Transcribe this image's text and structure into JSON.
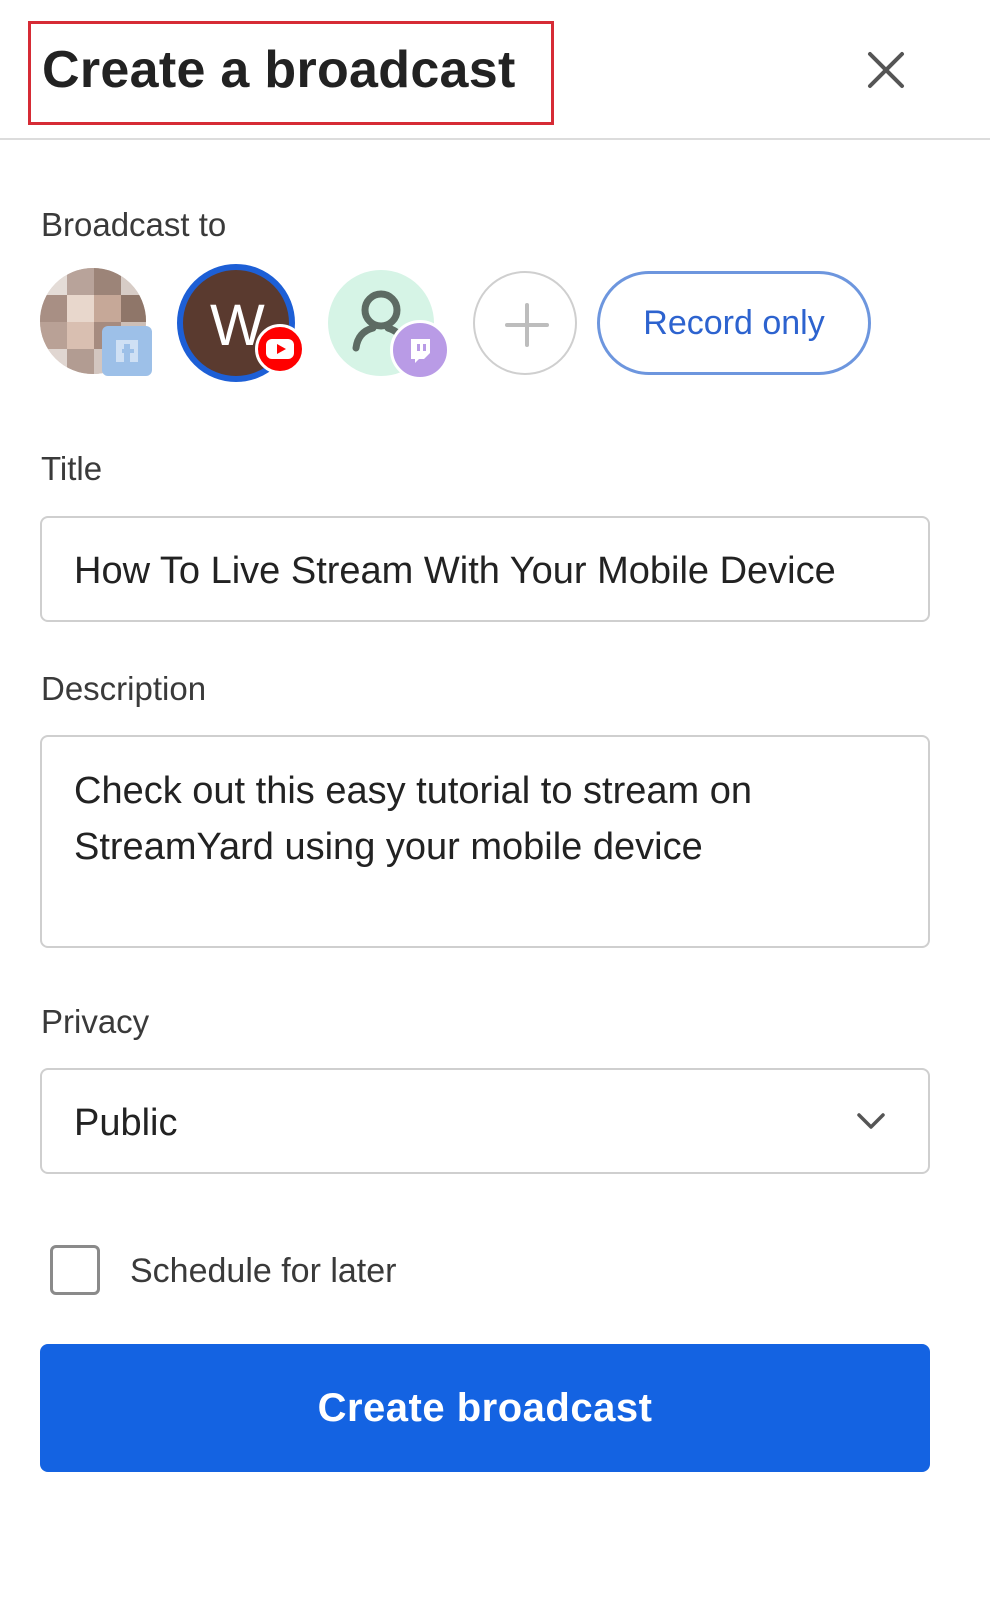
{
  "header": {
    "title": "Create a broadcast",
    "close_icon": "close-icon"
  },
  "destinations": {
    "label": "Broadcast to",
    "items": [
      {
        "name": "facebook-profile",
        "badge_icon": "facebook-icon"
      },
      {
        "name": "youtube-channel",
        "avatar_letter": "W",
        "badge_icon": "youtube-icon",
        "selected": true
      },
      {
        "name": "twitch-channel",
        "badge_icon": "twitch-icon"
      }
    ],
    "add_icon": "plus-icon",
    "record_only_label": "Record only"
  },
  "title_field": {
    "label": "Title",
    "value": "How To Live Stream With Your Mobile Device"
  },
  "description_field": {
    "label": "Description",
    "value": "Check out this easy tutorial to stream on StreamYard using your mobile device"
  },
  "privacy_field": {
    "label": "Privacy",
    "value": "Public",
    "chevron_icon": "chevron-down-icon"
  },
  "schedule": {
    "label": "Schedule for later",
    "checked": false
  },
  "submit": {
    "label": "Create broadcast"
  },
  "colors": {
    "primary": "#1463e2",
    "highlight_border": "#d62b35",
    "youtube_red": "#ff0000",
    "twitch_purple": "#b99be6"
  }
}
